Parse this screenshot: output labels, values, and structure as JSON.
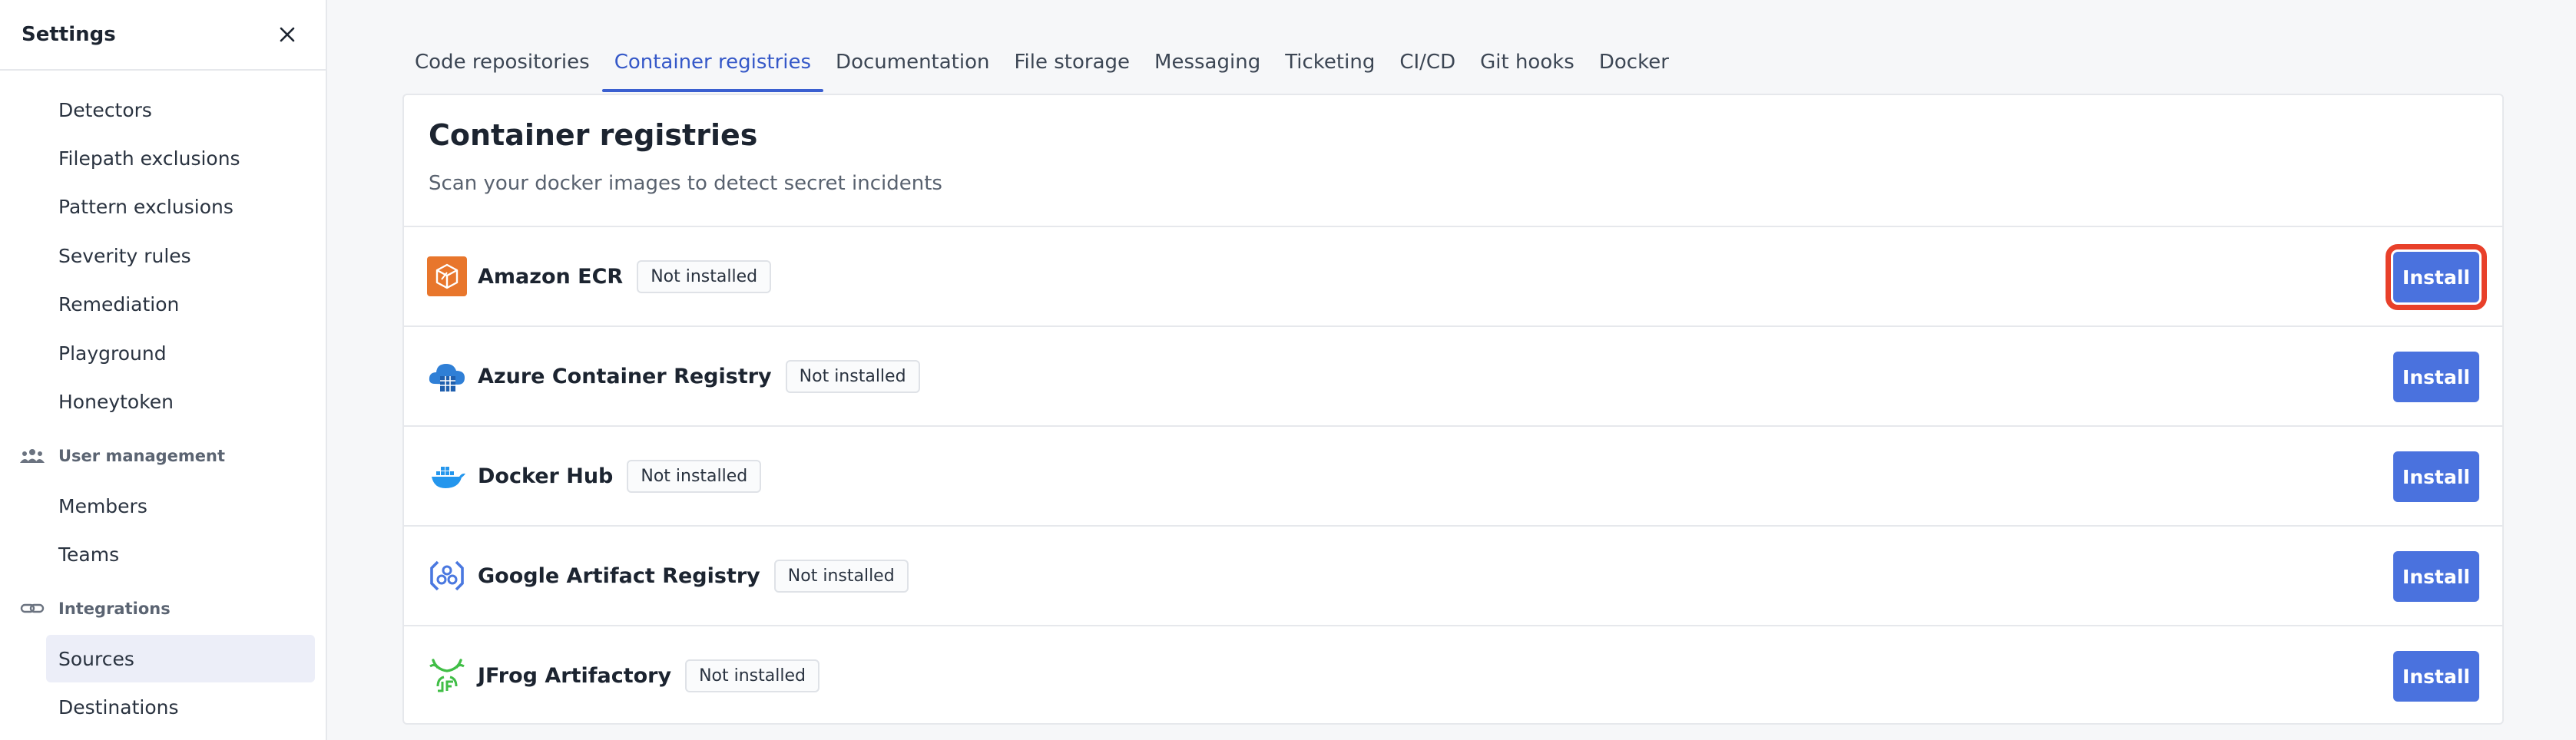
{
  "sidebar": {
    "title": "Settings",
    "items_top": [
      {
        "label": "Detectors"
      },
      {
        "label": "Filepath exclusions"
      },
      {
        "label": "Pattern exclusions"
      },
      {
        "label": "Severity rules"
      },
      {
        "label": "Remediation"
      },
      {
        "label": "Playground"
      },
      {
        "label": "Honeytoken"
      }
    ],
    "user_management": {
      "heading": "User management",
      "icon": "users-icon",
      "items": [
        {
          "label": "Members"
        },
        {
          "label": "Teams"
        }
      ]
    },
    "integrations": {
      "heading": "Integrations",
      "icon": "link-icon",
      "items": [
        {
          "label": "Sources",
          "active": true
        },
        {
          "label": "Destinations"
        }
      ]
    }
  },
  "tabs": [
    {
      "label": "Code repositories"
    },
    {
      "label": "Container registries",
      "active": true
    },
    {
      "label": "Documentation"
    },
    {
      "label": "File storage"
    },
    {
      "label": "Messaging"
    },
    {
      "label": "Ticketing"
    },
    {
      "label": "CI/CD"
    },
    {
      "label": "Git hooks"
    },
    {
      "label": "Docker"
    }
  ],
  "main": {
    "title": "Container registries",
    "description": "Scan your docker images to detect secret incidents",
    "install_label": "Install",
    "registries": [
      {
        "name": "Amazon ECR",
        "status": "Not installed",
        "icon": "amazon-ecr-icon",
        "color": "#e8762c"
      },
      {
        "name": "Azure Container Registry",
        "status": "Not installed",
        "icon": "azure-container-registry-icon",
        "color": "#2f7fd6"
      },
      {
        "name": "Docker Hub",
        "status": "Not installed",
        "icon": "docker-icon",
        "color": "#2496ed"
      },
      {
        "name": "Google Artifact Registry",
        "status": "Not installed",
        "icon": "google-artifact-registry-icon",
        "color": "#4a78e0"
      },
      {
        "name": "JFrog Artifactory",
        "status": "Not installed",
        "icon": "jfrog-icon",
        "color": "#40be46"
      }
    ]
  },
  "colors": {
    "accent": "#4a72de",
    "active_tab": "#3558c8",
    "highlight": "#e8402a"
  }
}
